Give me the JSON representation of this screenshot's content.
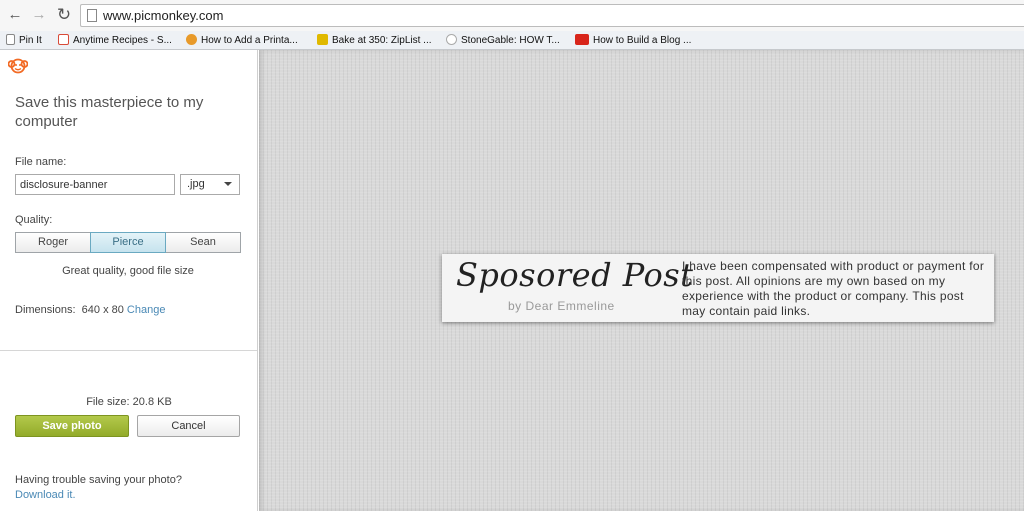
{
  "browser": {
    "url": "www.picmonkey.com",
    "bookmarks": [
      {
        "label": "Pin It",
        "icon": "page-icon",
        "color": "#ffffff"
      },
      {
        "label": "Anytime Recipes - S...",
        "icon": "recipe-icon",
        "color": "#d84a38"
      },
      {
        "label": "How to Add a Printa...",
        "icon": "bird-icon",
        "color": "#e89a2a"
      },
      {
        "label": "Bake at 350: ZipList ...",
        "icon": "folder-icon",
        "color": "#e0b900"
      },
      {
        "label": "StoneGable: HOW T...",
        "icon": "globe-icon",
        "color": "#cfcfcf"
      },
      {
        "label": "How to Build a Blog ...",
        "icon": "youtube-icon",
        "color": "#d8251b"
      }
    ]
  },
  "panel": {
    "title": "Save this masterpiece to my computer",
    "file_name_label": "File name:",
    "file_name_value": "disclosure-banner",
    "extension": ".jpg",
    "quality_label": "Quality:",
    "quality_options": [
      "Roger",
      "Pierce",
      "Sean"
    ],
    "quality_selected": "Pierce",
    "quality_description": "Great quality, good file size",
    "dimensions_label": "Dimensions:",
    "dimensions_value": "640 x 80",
    "change_link": "Change",
    "file_size_label": "File size:",
    "file_size_value": "20.8 KB",
    "save_label": "Save photo",
    "cancel_label": "Cancel",
    "trouble_text": "Having trouble saving your photo?",
    "download_link": "Download it."
  },
  "banner": {
    "title": "Sposored Post",
    "subtitle": "by Dear Emmeline",
    "text": "I have been compensated with product or payment for this post. All opinions are my own based on my experience with the product or company. This post may contain paid links."
  },
  "colors": {
    "accent_green": "#9db236",
    "link_blue": "#4a89b5",
    "selected_quality": "#c6e3ee",
    "logo_orange": "#f26a24"
  }
}
